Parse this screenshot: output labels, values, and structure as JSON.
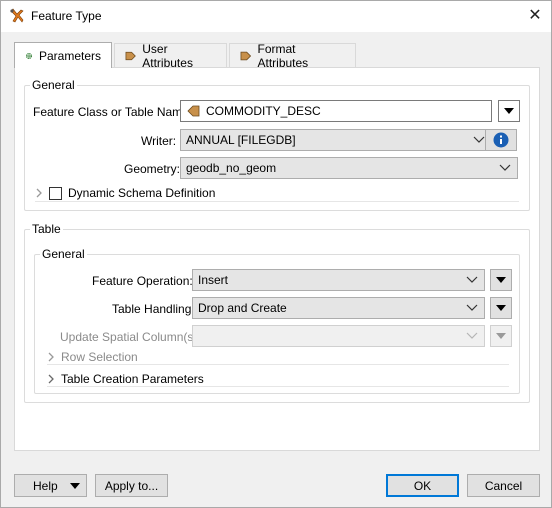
{
  "window": {
    "title": "Feature Type",
    "close_glyph": "✕"
  },
  "tabs": [
    {
      "label": "Parameters",
      "icon": "gear-icon",
      "active": true
    },
    {
      "label": "User Attributes",
      "icon": "arrow-right-icon",
      "active": false
    },
    {
      "label": "Format Attributes",
      "icon": "arrow-right-icon",
      "active": false
    }
  ],
  "general": {
    "title": "General",
    "feature_class_label": "Feature Class or Table Name:",
    "feature_class_value": "COMMODITY_DESC",
    "writer_label": "Writer:",
    "writer_value": "ANNUAL [FILEGDB]",
    "geometry_label": "Geometry:",
    "geometry_value": "geodb_no_geom",
    "dynamic_schema_label": "Dynamic Schema Definition",
    "dynamic_schema_checked": false
  },
  "table": {
    "title": "Table",
    "general_title": "General",
    "feature_operation_label": "Feature Operation:",
    "feature_operation_value": "Insert",
    "table_handling_label": "Table Handling:",
    "table_handling_value": "Drop and Create",
    "update_spatial_label": "Update Spatial Column(s):",
    "update_spatial_value": "",
    "row_selection_label": "Row Selection",
    "table_creation_label": "Table Creation Parameters"
  },
  "footer": {
    "help_label": "Help",
    "apply_label": "Apply to...",
    "ok_label": "OK",
    "cancel_label": "Cancel"
  },
  "colors": {
    "accent": "#0078d7",
    "arrow_orange": "#c8904a",
    "info_blue": "#1a5fb4"
  }
}
